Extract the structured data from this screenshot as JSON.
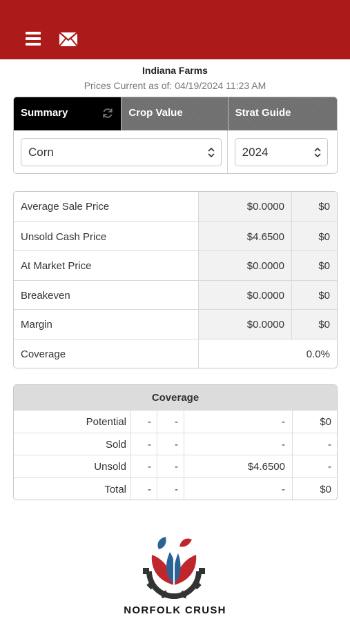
{
  "header": {
    "menu_icon": "hamburger-menu-icon",
    "mail_icon": "envelope-icon",
    "bar_color": "#ad1a1a"
  },
  "farm": {
    "name": "Indiana Farms",
    "prices_current": "Prices Current as of: 04/19/2024 11:23 AM"
  },
  "tabs": [
    {
      "label": "Summary",
      "active": true,
      "icon": "refresh-icon"
    },
    {
      "label": "Crop Value",
      "active": false
    },
    {
      "label": "Strat Guide",
      "active": false
    }
  ],
  "selectors": {
    "crop": "Corn",
    "year": "2024"
  },
  "summary_rows": [
    {
      "label": "Average Sale Price",
      "price": "$0.0000",
      "amount": "$0"
    },
    {
      "label": "Unsold Cash Price",
      "price": "$4.6500",
      "amount": "$0"
    },
    {
      "label": "At Market Price",
      "price": "$0.0000",
      "amount": "$0"
    },
    {
      "label": "Breakeven",
      "price": "$0.0000",
      "amount": "$0"
    },
    {
      "label": "Margin",
      "price": "$0.0000",
      "amount": "$0"
    },
    {
      "label": "Coverage",
      "value": "0.0%"
    }
  ],
  "coverage": {
    "title": "Coverage",
    "rows": [
      {
        "label": "Potential",
        "a": "-",
        "b": "-",
        "c": "-",
        "d": "$0"
      },
      {
        "label": "Sold",
        "a": "-",
        "b": "-",
        "c": "-",
        "d": "-"
      },
      {
        "label": "Unsold",
        "a": "-",
        "b": "-",
        "c": "$4.6500",
        "d": "-"
      },
      {
        "label": "Total",
        "a": "-",
        "b": "-",
        "c": "-",
        "d": "$0"
      }
    ]
  },
  "brand": {
    "logo_text": "NORFOLK CRUSH"
  }
}
